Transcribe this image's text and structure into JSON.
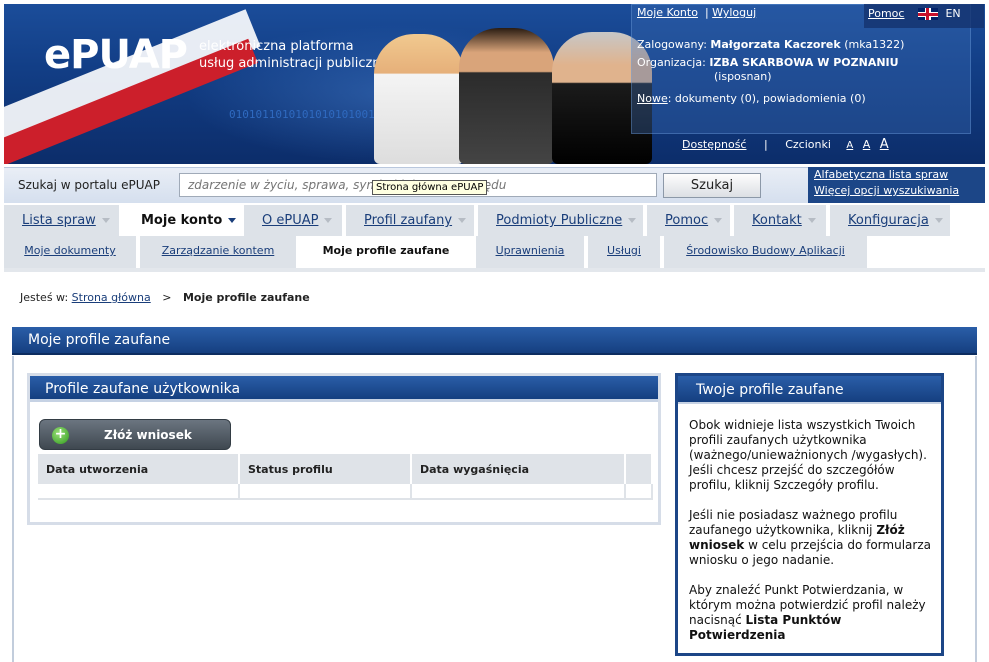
{
  "header": {
    "logo_text": "ePUAP",
    "logo_sub_1": "elektroniczna platforma",
    "logo_sub_2": "usług administracji publicznej",
    "binary": "0101011010101010101001010",
    "my_account": "Moje Konto",
    "separator": "|",
    "logout": "Wyloguj",
    "help": "Pomoc",
    "lang": "EN",
    "logged_label": "Zalogowany:",
    "user_name": "Małgorzata Kaczorek",
    "user_login": "(mka1322)",
    "org_label": "Organizacja:",
    "org_name": "IZBA SKARBOWA W POZNANIU",
    "org_code": "(isposnan)",
    "new_label": "Nowe",
    "new_text": ": dokumenty (0), powiadomienia (0)",
    "accessibility": "Dostępność",
    "fonts_label": "Czcionki",
    "font_a1": "A",
    "font_a2": "A",
    "font_a3": "A"
  },
  "search": {
    "label": "Szukaj w portalu ePUAP",
    "placeholder": "zdarzenie w życiu, sprawa, symbol lub nazwa urzędu",
    "button": "Szukaj",
    "tooltip": "Strona główna ePUAP",
    "link_alpha": "Alfabetyczna lista spraw",
    "link_more": "Więcej opcji wyszukiwania"
  },
  "nav": {
    "tabs": [
      {
        "label": "Lista spraw"
      },
      {
        "label": "Moje konto"
      },
      {
        "label": "O ePUAP"
      },
      {
        "label": "Profil zaufany"
      },
      {
        "label": "Podmioty Publiczne"
      },
      {
        "label": "Pomoc"
      },
      {
        "label": "Kontakt"
      },
      {
        "label": "Konfiguracja"
      }
    ],
    "subtabs": [
      {
        "label": "Moje dokumenty"
      },
      {
        "label": "Zarządzanie kontem"
      },
      {
        "label": "Moje profile zaufane"
      },
      {
        "label": "Uprawnienia"
      },
      {
        "label": "Usługi"
      },
      {
        "label": "Środowisko Budowy Aplikacji"
      }
    ]
  },
  "breadcrumb": {
    "prefix": "Jesteś w:",
    "home": "Strona główna",
    "sep": ">",
    "current": "Moje profile zaufane"
  },
  "panel": {
    "title": "Moje profile zaufane",
    "profiles_title": "Profile zaufane użytkownika",
    "apply_button": "Złóż wniosek",
    "apply_icon": "plus-icon",
    "columns": [
      "Data utworzenia",
      "Status profilu",
      "Data wygaśnięcia",
      ""
    ]
  },
  "sidebar": {
    "title": "Twoje profile zaufane",
    "p1": "Obok widnieje lista wszystkich Twoich profili zaufanych użytkownika (ważnego/unieważnionych /wygasłych). Jeśli chcesz przejść do szczegółów profilu, kliknij Szczegóły profilu.",
    "p2_a": "Jeśli nie posiadasz ważnego profilu zaufanego użytkownika, kliknij ",
    "p2_b": "Złóż wniosek",
    "p2_c": " w celu przejścia do formularza wniosku o jego nadanie.",
    "p3_a": "Aby znaleźć Punkt Potwierdzania, w którym można potwierdzić profil należy nacisnąć ",
    "p3_b": "Lista Punktów Potwierdzenia"
  }
}
